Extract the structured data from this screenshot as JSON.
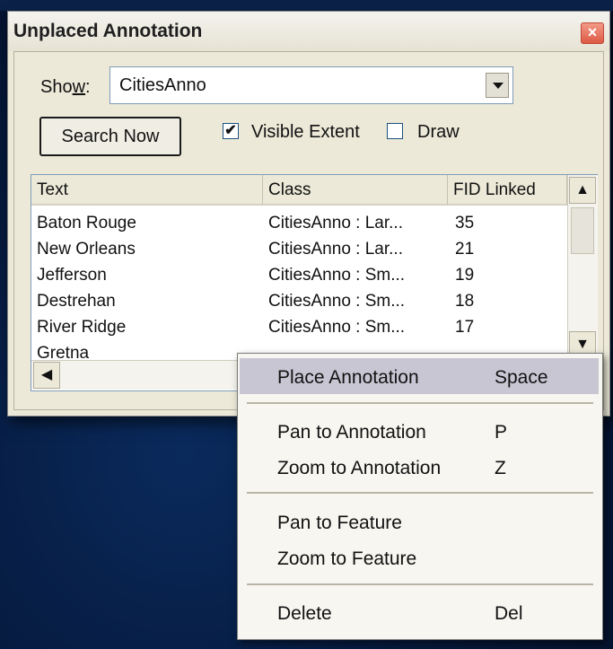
{
  "dialog": {
    "title": "Unplaced Annotation",
    "close_symbol": "×",
    "show_label_before": "Sho",
    "show_label_underline": "w",
    "show_label_after": ":",
    "show_value": "CitiesAnno",
    "search_button": "Search Now",
    "visible_extent": {
      "label": "Visible Extent",
      "checked": true
    },
    "draw": {
      "label": "Draw",
      "checked": false
    }
  },
  "table": {
    "columns": [
      "Text",
      "Class",
      "FID Linked"
    ],
    "rows": [
      {
        "text": "Baton Rouge",
        "class": "CitiesAnno : Lar...",
        "fid": "35"
      },
      {
        "text": "New Orleans",
        "class": "CitiesAnno : Lar...",
        "fid": "21"
      },
      {
        "text": "Jefferson",
        "class": "CitiesAnno : Sm...",
        "fid": "19"
      },
      {
        "text": "Destrehan",
        "class": "CitiesAnno : Sm...",
        "fid": "18"
      },
      {
        "text": "River Ridge",
        "class": "CitiesAnno : Sm...",
        "fid": "17"
      },
      {
        "text": "Gretna",
        "class": "",
        "fid": ""
      }
    ]
  },
  "context_menu": {
    "items": [
      {
        "label": "Place Annotation",
        "shortcut": "Space"
      },
      {
        "label": "Pan to Annotation",
        "shortcut": "P"
      },
      {
        "label": "Zoom to Annotation",
        "shortcut": "Z"
      },
      {
        "label": "Pan to Feature",
        "shortcut": ""
      },
      {
        "label": "Zoom to Feature",
        "shortcut": ""
      },
      {
        "label": "Delete",
        "shortcut": "Del"
      }
    ]
  },
  "icons": {
    "close": "close-icon",
    "dropdown": "chevron-down-icon",
    "scroll_up": "arrow-up-icon",
    "scroll_down": "arrow-down-icon",
    "scroll_left": "arrow-left-icon",
    "check": "checkmark-icon"
  },
  "colors": {
    "dialog_bg": "#ece9d8",
    "menu_highlight": "#c9c6d4",
    "close_button": "#dd5a45",
    "desktop_bg": "#061a3e"
  }
}
